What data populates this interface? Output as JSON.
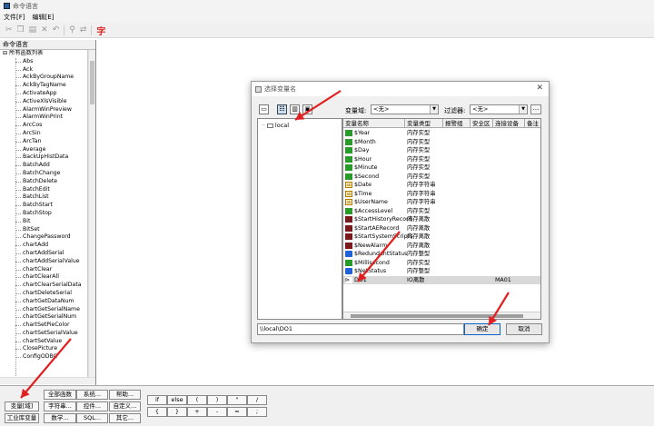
{
  "app": {
    "title": "命令语言"
  },
  "menu": {
    "file": "文件[F]",
    "edit": "编辑[E]"
  },
  "toolbar": {
    "zi": "字"
  },
  "panel": {
    "header": "命令语言"
  },
  "tree": {
    "root": "所有函数列表",
    "items": [
      "Abs",
      "Ack",
      "AckByGroupName",
      "AckByTagName",
      "ActivateApp",
      "ActiveXlsVisible",
      "AlarmWinPreview",
      "AlarmWinPrint",
      "ArcCos",
      "ArcSin",
      "ArcTan",
      "Average",
      "BackUpHistData",
      "BatchAdd",
      "BatchChange",
      "BatchDelete",
      "BatchEdit",
      "BatchList",
      "BatchStart",
      "BatchStop",
      "Bit",
      "BitSet",
      "ChangePassword",
      "chartAdd",
      "chartAddSerial",
      "chartAddSerialValue",
      "chartClear",
      "chartClearAll",
      "chartClearSerialData",
      "chartDeleteSerial",
      "chartGetDataNum",
      "chartGetSerialName",
      "chartGetSerialNum",
      "chartSetPieColor",
      "chartSetSerialValue",
      "chartSetValue",
      "ClosePicture",
      "ConfigODBC"
    ]
  },
  "bottom_buttons": {
    "variable": "变量[域]",
    "industrial": "工业库变量",
    "all_funcs": "全部函数",
    "string": "字符串...",
    "math": "数学...",
    "system": "系统...",
    "control": "控件...",
    "sql": "SQL...",
    "help": "帮助...",
    "custom": "自定义...",
    "other": "其它..."
  },
  "ops": {
    "row1": [
      "if",
      "else",
      "(",
      ")",
      "\"",
      "/"
    ],
    "row2": [
      "{",
      "}",
      "+",
      "-",
      "=",
      ";"
    ]
  },
  "dialog": {
    "title": "选择变量名",
    "close": "✕",
    "domain_label": "变量域:",
    "domain_value": "<无>",
    "filter_label": "过滤器:",
    "filter_value": "<无>",
    "dots": "...",
    "tree_node": "local",
    "columns": [
      "变量名称",
      "变量类型",
      "报警组",
      "安全区",
      "连接设备",
      "备注"
    ],
    "rows": [
      {
        "icon": "green",
        "name": "$Year",
        "type": "内存实型",
        "device": ""
      },
      {
        "icon": "green",
        "name": "$Month",
        "type": "内存实型",
        "device": ""
      },
      {
        "icon": "green",
        "name": "$Day",
        "type": "内存实型",
        "device": ""
      },
      {
        "icon": "green",
        "name": "$Hour",
        "type": "内存实型",
        "device": ""
      },
      {
        "icon": "green",
        "name": "$Minute",
        "type": "内存实型",
        "device": ""
      },
      {
        "icon": "green",
        "name": "$Second",
        "type": "内存实型",
        "device": ""
      },
      {
        "icon": "str",
        "name": "$Date",
        "type": "内存字符串",
        "device": ""
      },
      {
        "icon": "str",
        "name": "$Time",
        "type": "内存字符串",
        "device": ""
      },
      {
        "icon": "str",
        "name": "$UserName",
        "type": "内存字符串",
        "device": ""
      },
      {
        "icon": "green",
        "name": "$AccessLevel",
        "type": "内存实型",
        "device": ""
      },
      {
        "icon": "func",
        "name": "$StartHistoryRecord",
        "type": "内存离散",
        "device": ""
      },
      {
        "icon": "func",
        "name": "$StartAERecord",
        "type": "内存离散",
        "device": ""
      },
      {
        "icon": "func",
        "name": "$StartSystemScripts",
        "type": "内存离散",
        "device": ""
      },
      {
        "icon": "func",
        "name": "$NewAlarm",
        "type": "内存离散",
        "device": ""
      },
      {
        "icon": "ioblue",
        "name": "$RedundantStatus",
        "type": "内存整型",
        "device": ""
      },
      {
        "icon": "green",
        "name": "$Millisecond",
        "type": "内存实型",
        "device": ""
      },
      {
        "icon": "ioblue",
        "name": "$NetStatus",
        "type": "内存整型",
        "device": ""
      },
      {
        "icon": "io",
        "name": "DO1",
        "type": "IO离散",
        "device": "MA01"
      }
    ],
    "path": "\\\\local\\DO1",
    "ok": "确定",
    "cancel": "取消"
  },
  "annotation_color": "#e02020"
}
